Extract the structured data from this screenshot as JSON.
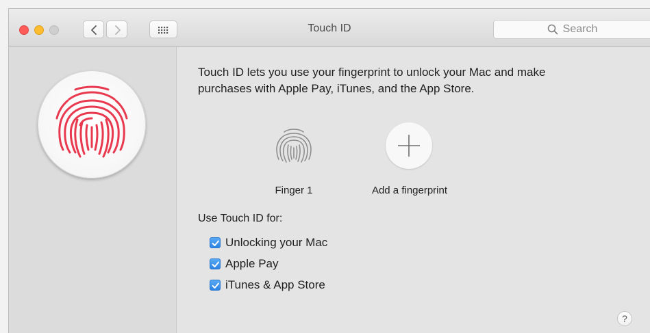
{
  "window": {
    "title": "Touch ID",
    "search_placeholder": "Search"
  },
  "toolbar": {
    "back_icon": "chevron-left-icon",
    "forward_icon": "chevron-right-icon",
    "grid_icon": "grid-icon"
  },
  "main": {
    "intro": "Touch ID lets you use your fingerprint to unlock your Mac and make purchases with Apple Pay, iTunes, and the App Store.",
    "fingers": [
      {
        "label": "Finger 1",
        "icon": "fingerprint-icon"
      }
    ],
    "add_label": "Add a fingerprint",
    "use_for_label": "Use Touch ID for:",
    "options": [
      {
        "label": "Unlocking your Mac",
        "checked": true
      },
      {
        "label": "Apple Pay",
        "checked": true
      },
      {
        "label": "iTunes & App Store",
        "checked": true
      }
    ],
    "help_label": "?"
  },
  "colors": {
    "accent": "#2c83e3",
    "fingerprint_red": "#e8394f",
    "close": "#fc5b57",
    "minimize": "#fdbd2f"
  }
}
